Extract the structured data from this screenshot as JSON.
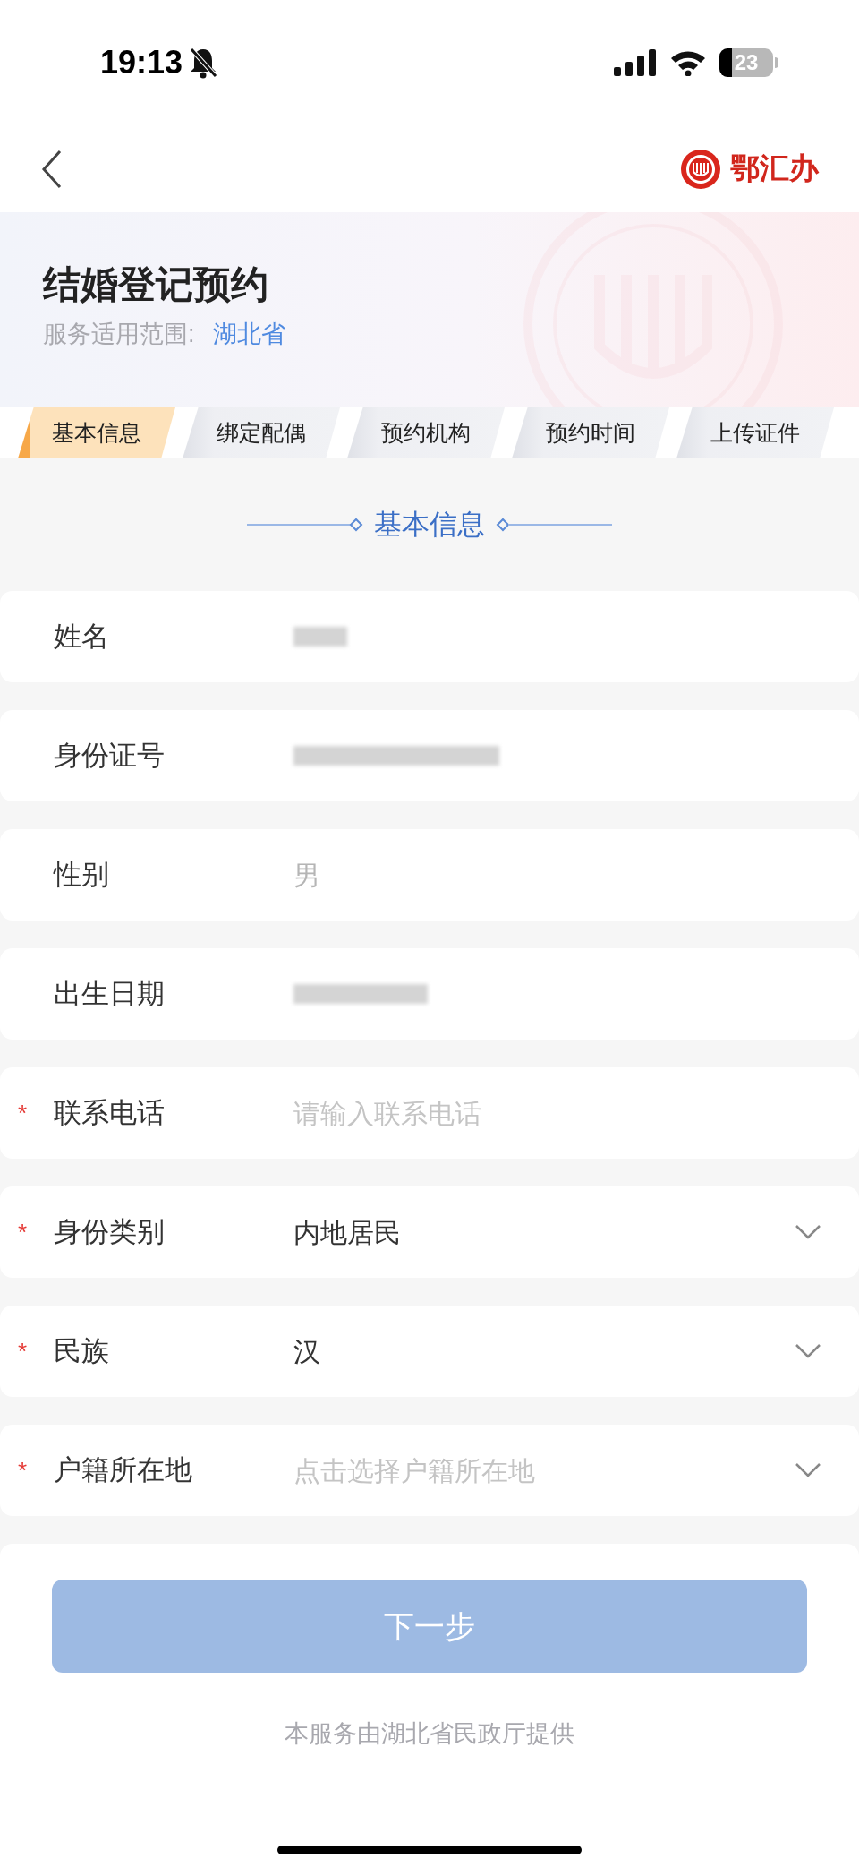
{
  "status_bar": {
    "time": "19:13",
    "battery": "23"
  },
  "nav": {
    "logo_text": "鄂汇办"
  },
  "header": {
    "title": "结婚登记预约",
    "scope_label": "服务适用范围:",
    "scope_value": "湖北省"
  },
  "tabs": [
    {
      "label": "基本信息",
      "selected": true
    },
    {
      "label": "绑定配偶",
      "selected": false
    },
    {
      "label": "预约机构",
      "selected": false
    },
    {
      "label": "预约时间",
      "selected": false
    },
    {
      "label": "上传证件",
      "selected": false
    }
  ],
  "section_title": "基本信息",
  "rows": [
    {
      "label": "姓名",
      "kind": "redacted"
    },
    {
      "label": "身份证号",
      "kind": "redacted"
    },
    {
      "label": "性别",
      "kind": "readonly",
      "value": "男"
    },
    {
      "label": "出生日期",
      "kind": "redacted"
    },
    {
      "label": "联系电话",
      "required_mark": "*",
      "kind": "input",
      "placeholder": "请输入联系电话"
    },
    {
      "label": "身份类别",
      "required_mark": "*",
      "kind": "select",
      "value": "内地居民"
    },
    {
      "label": "民族",
      "required_mark": "*",
      "kind": "select",
      "value": "汉"
    },
    {
      "label": "户籍所在地",
      "required_mark": "*",
      "kind": "select",
      "placeholder": "点击选择户籍所在地"
    },
    {
      "kind": "hidden"
    }
  ],
  "next_button": {
    "label": "下一步",
    "disabled": true
  },
  "footer": "本服务由湖北省民政厅提供"
}
